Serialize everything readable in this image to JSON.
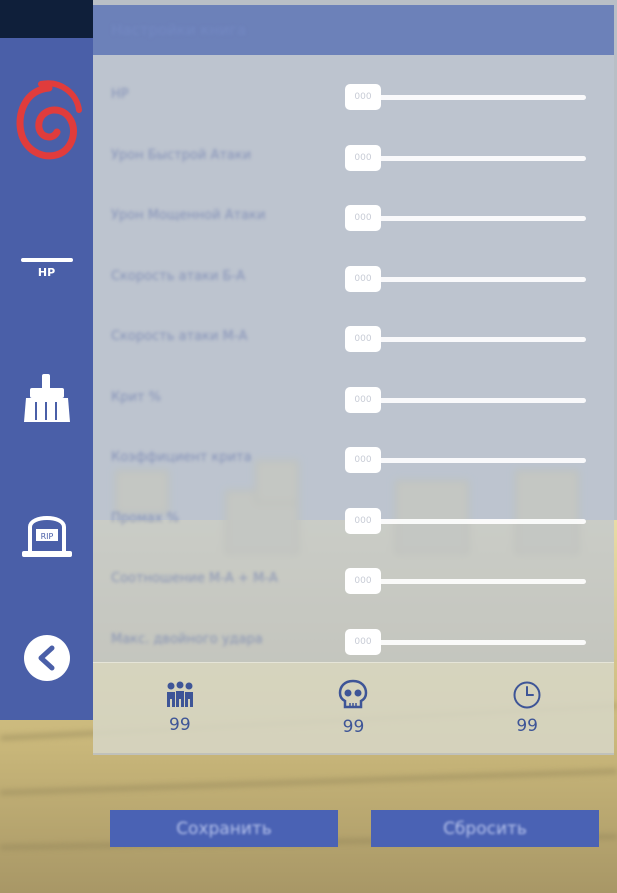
{
  "panel": {
    "title": "Настройки книга"
  },
  "sliders": [
    {
      "label": "HP",
      "value": "000"
    },
    {
      "label": "Урон Быстрой Атаки",
      "value": "000"
    },
    {
      "label": "Урон Мощенной Атаки",
      "value": "000"
    },
    {
      "label": "Скорость атаки Б-А",
      "value": "000"
    },
    {
      "label": "Скорость атаки  М-А",
      "value": "000"
    },
    {
      "label": "Крит %",
      "value": "000"
    },
    {
      "label": "Коэффициент крита",
      "value": "000"
    },
    {
      "label": "Промах %",
      "value": "000"
    },
    {
      "label": "Соотношение   М-А  +  М-А",
      "value": "000"
    },
    {
      "label": "Макс. двойного удара",
      "value": "000"
    }
  ],
  "sidebar": {
    "hp_label": "HP"
  },
  "stats": {
    "players": "99",
    "kills": "99",
    "time": "99"
  },
  "buttons": {
    "save": "Сохранить",
    "reset": "Сбросить"
  },
  "colors": {
    "sidebar": "#4a5fa8",
    "accent": "#3e5597",
    "button": "#4a62b4"
  }
}
